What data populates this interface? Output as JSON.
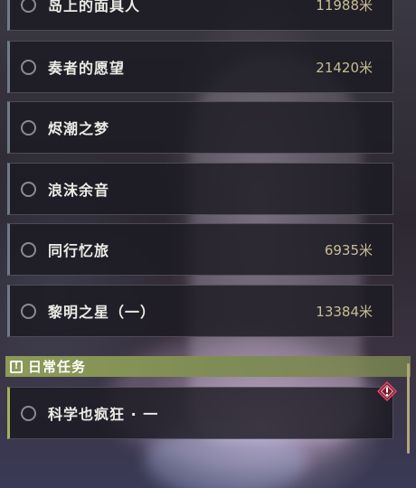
{
  "quests": [
    {
      "name": "岛上的面具人",
      "distance": "11988米"
    },
    {
      "name": "奏者的愿望",
      "distance": "21420米"
    },
    {
      "name": "烬潮之梦",
      "distance": ""
    },
    {
      "name": "浪沫余音",
      "distance": ""
    },
    {
      "name": "同行忆旅",
      "distance": "6935米"
    },
    {
      "name": "黎明之星（一）",
      "distance": "13384米"
    }
  ],
  "daily_section": {
    "title": "日常任务",
    "icon": "exclamation-icon",
    "quests": [
      {
        "name": "科学也疯狂 · 一",
        "distance": "",
        "alert_icon": "warning-diamond-icon"
      }
    ]
  },
  "colors": {
    "section_bar": "#8c9a58",
    "daily_accent": "#a2b25a",
    "distance_text": "#c8bd96",
    "alert": "#c0334b"
  }
}
